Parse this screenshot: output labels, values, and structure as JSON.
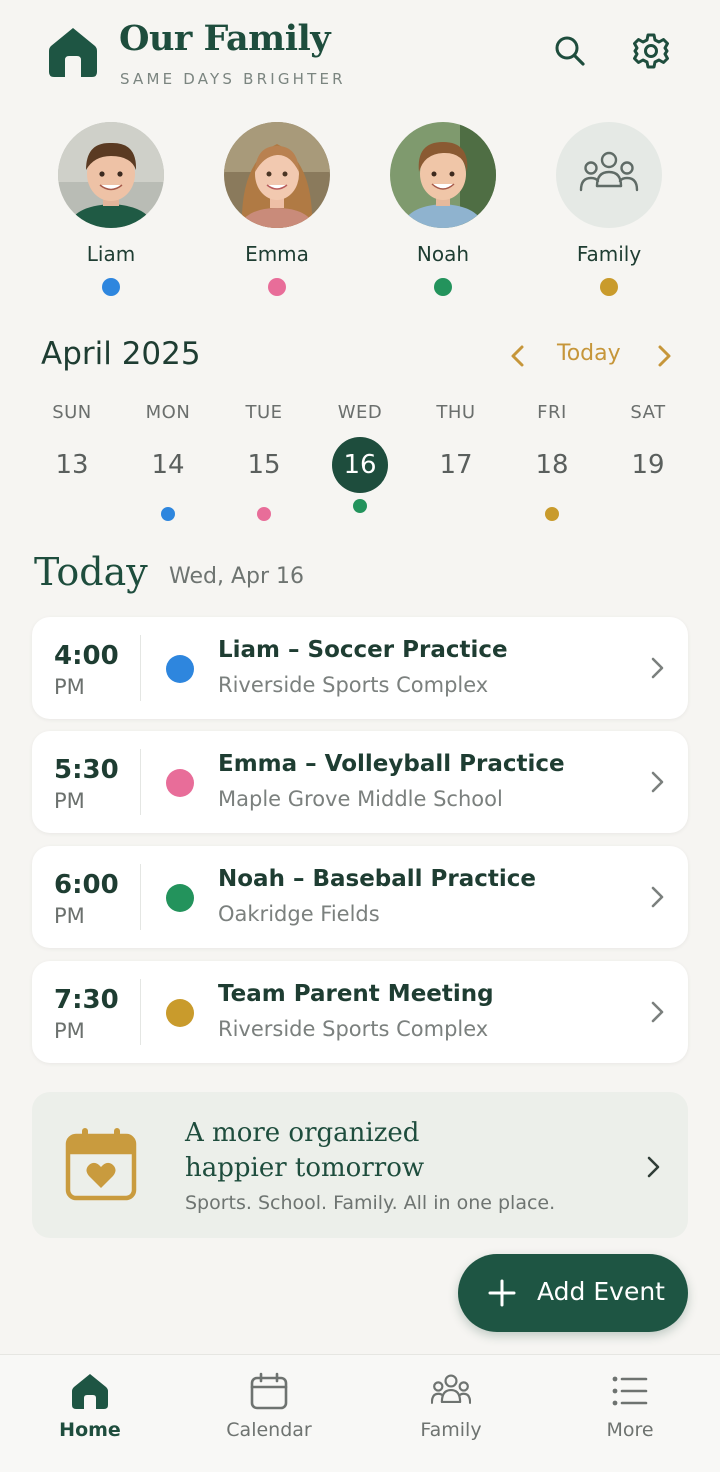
{
  "header": {
    "title": "Our Family",
    "tagline": "SAME DAYS BRIGHTER",
    "icons": [
      "home-icon",
      "search-icon",
      "gear-icon"
    ]
  },
  "members": [
    {
      "name": "Liam",
      "color": "#2e86de"
    },
    {
      "name": "Emma",
      "color": "#e86d99"
    },
    {
      "name": "Noah",
      "color": "#23935c"
    },
    {
      "name": "Family",
      "color": "#c99b2c"
    }
  ],
  "calendar": {
    "month": "April 2025",
    "today_button": "Today",
    "days": [
      {
        "name": "SUN",
        "num": "13",
        "dot": null,
        "selected": false
      },
      {
        "name": "MON",
        "num": "14",
        "dot": "#2e86de",
        "selected": false
      },
      {
        "name": "TUE",
        "num": "15",
        "dot": "#e86d99",
        "selected": false
      },
      {
        "name": "WED",
        "num": "16",
        "dot": "#23935c",
        "selected": true
      },
      {
        "name": "THU",
        "num": "17",
        "dot": null,
        "selected": false
      },
      {
        "name": "FRI",
        "num": "18",
        "dot": "#c99b2c",
        "selected": false
      },
      {
        "name": "SAT",
        "num": "19",
        "dot": null,
        "selected": false
      }
    ]
  },
  "today": {
    "title": "Today",
    "date": "Wed, Apr 16",
    "events": [
      {
        "time": "4:00",
        "ampm": "PM",
        "title": "Liam – Soccer Practice",
        "location": "Riverside Sports Complex",
        "color": "#2e86de"
      },
      {
        "time": "5:30",
        "ampm": "PM",
        "title": "Emma – Volleyball Practice",
        "location": "Maple Grove Middle School",
        "color": "#e86d99"
      },
      {
        "time": "6:00",
        "ampm": "PM",
        "title": "Noah – Baseball Practice",
        "location": "Oakridge Fields",
        "color": "#23935c"
      },
      {
        "time": "7:30",
        "ampm": "PM",
        "title": "Team Parent Meeting",
        "location": "Riverside Sports Complex",
        "color": "#c99b2c"
      }
    ]
  },
  "promo": {
    "line1": "A more organized",
    "line2": "happier tomorrow",
    "subtitle": "Sports. School. Family. All in one place."
  },
  "fab": {
    "label": "Add Event"
  },
  "bottom_nav": [
    {
      "label": "Home",
      "icon": "home-icon",
      "active": true
    },
    {
      "label": "Calendar",
      "icon": "calendar-icon",
      "active": false
    },
    {
      "label": "Family",
      "icon": "family-icon",
      "active": false
    },
    {
      "label": "More",
      "icon": "list-icon",
      "active": false
    }
  ],
  "colors": {
    "primary": "#1e4d3d",
    "accent": "#c6963a",
    "background": "#f6f5f2"
  }
}
